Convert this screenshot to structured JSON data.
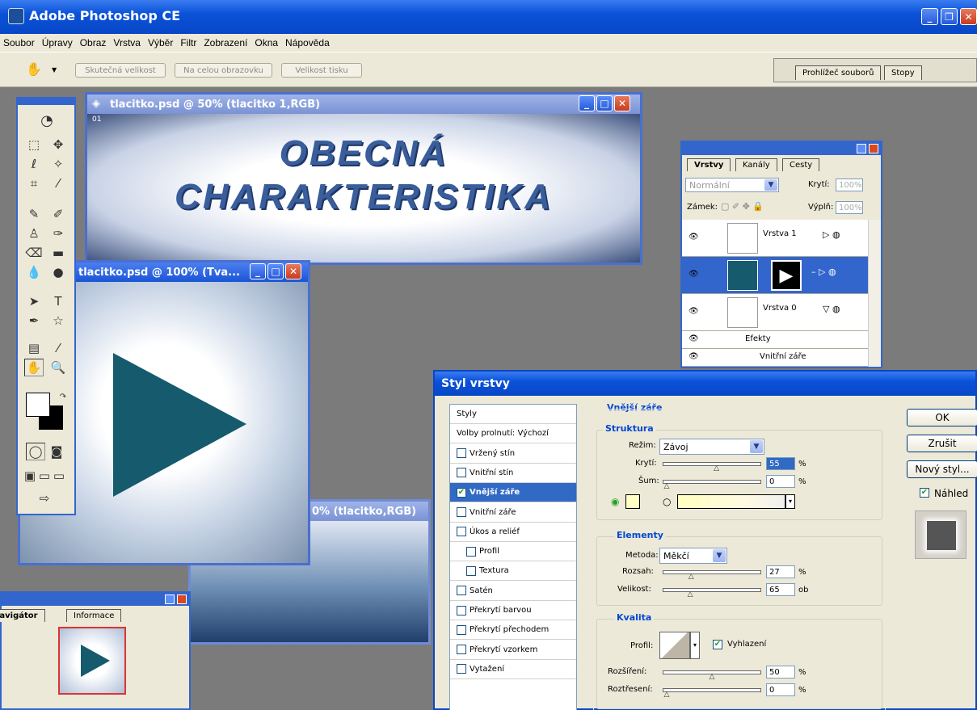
{
  "app": {
    "title": "Adobe Photoshop CE"
  },
  "menu": [
    "Soubor",
    "Úpravy",
    "Obraz",
    "Vrstva",
    "Výběr",
    "Filtr",
    "Zobrazení",
    "Okna",
    "Nápověda"
  ],
  "options_bar": {
    "buttons": [
      "Skutečná velikost",
      "Na celou obrazovku",
      "Velikost tisku"
    ],
    "tabs": [
      "Prohlížeč souborů",
      "Stopy"
    ]
  },
  "doc1": {
    "title": "tlacitko.psd @ 50% (tlacitko 1,RGB)",
    "ruler_label": "01",
    "line1": "OBECNÁ",
    "line2": "CHARAKTERISTIKA"
  },
  "doc2": {
    "title": "tlacitko.psd @ 100% (Tva..."
  },
  "doc3": {
    "title_fragment": "0% (tlacitko,RGB)"
  },
  "navigator": {
    "tabs": [
      "Navigátor",
      "Informace"
    ]
  },
  "layers_panel": {
    "tabs": [
      "Vrstvy",
      "Kanály",
      "Cesty"
    ],
    "blend_mode": "Normální",
    "opacity_label": "Krytí:",
    "opacity_value": "100%",
    "lock_label": "Zámek:",
    "fill_label": "Výplň:",
    "fill_value": "100%",
    "layers": [
      {
        "name": "Vrstva 1"
      },
      {
        "name": ""
      },
      {
        "name": "Vrstva 0"
      }
    ],
    "effects_label": "Efekty",
    "effect_item": "Vnitřní záře"
  },
  "dialog": {
    "title": "Styl vrstvy",
    "styles": [
      {
        "label": "Styly",
        "checkbox": false
      },
      {
        "label": "Volby prolnutí: Výchozí",
        "checkbox": false
      },
      {
        "label": "Vržený stín",
        "checkbox": true,
        "checked": false
      },
      {
        "label": "Vnitřní stín",
        "checkbox": true,
        "checked": false
      },
      {
        "label": "Vnější záře",
        "checkbox": true,
        "checked": true,
        "selected": true
      },
      {
        "label": "Vnitřní záře",
        "checkbox": true,
        "checked": false
      },
      {
        "label": "Úkos a reliéf",
        "checkbox": true,
        "checked": false
      },
      {
        "label": "Profil",
        "checkbox": true,
        "checked": false,
        "indent": true
      },
      {
        "label": "Textura",
        "checkbox": true,
        "checked": false,
        "indent": true
      },
      {
        "label": "Satén",
        "checkbox": true,
        "checked": false
      },
      {
        "label": "Překrytí barvou",
        "checkbox": true,
        "checked": false
      },
      {
        "label": "Překrytí přechodem",
        "checkbox": true,
        "checked": false
      },
      {
        "label": "Překrytí vzorkem",
        "checkbox": true,
        "checked": false
      },
      {
        "label": "Vytažení",
        "checkbox": true,
        "checked": false
      }
    ],
    "section_title": "Vnější záře",
    "structure": {
      "title": "Struktura",
      "mode_label": "Režim:",
      "mode_value": "Závoj",
      "opacity_label": "Krytí:",
      "opacity_value": "55",
      "noise_label": "Šum:",
      "noise_value": "0",
      "unit": "%"
    },
    "elements": {
      "title": "Elementy",
      "method_label": "Metoda:",
      "method_value": "Měkčí",
      "spread_label": "Rozsah:",
      "spread_value": "27",
      "spread_unit": "%",
      "size_label": "Velikost:",
      "size_value": "65",
      "size_unit": "ob"
    },
    "quality": {
      "title": "Kvalita",
      "contour_label": "Profil:",
      "antialias_label": "Vyhlazení",
      "range_label": "Rozšíření:",
      "range_value": "50",
      "jitter_label": "Roztřesení:",
      "jitter_value": "0",
      "unit": "%"
    },
    "buttons": {
      "ok": "OK",
      "cancel": "Zrušit",
      "new_style": "Nový styl...",
      "preview": "Náhled"
    }
  },
  "colors": {
    "accent": "#0a52d9",
    "play": "#165a6e",
    "workspace": "#7b7b7b"
  }
}
